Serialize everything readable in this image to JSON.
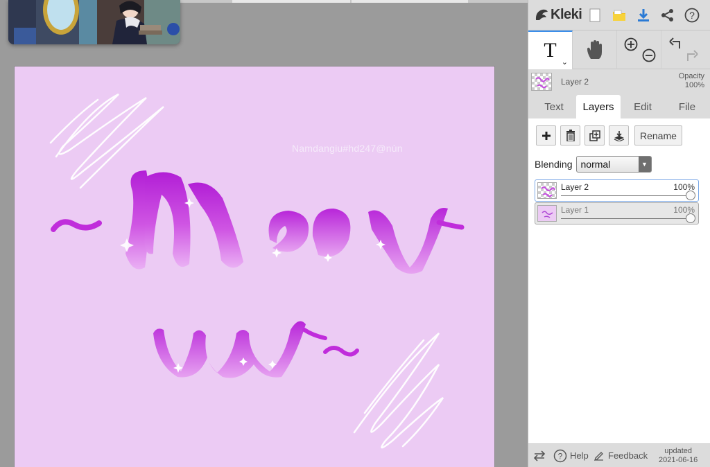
{
  "app": {
    "name": "Kleki"
  },
  "canvas": {
    "watermark": "Namdangiu#hd247@nùn",
    "background_color": "#eccbf4",
    "artwork": [
      {
        "id": "lettering-line-1",
        "kind": "lettering",
        "style": "pink/purple 3D brush script"
      },
      {
        "id": "lettering-line-2",
        "kind": "lettering",
        "style": "pink/purple 3D brush script"
      },
      {
        "id": "scribble-top-left",
        "kind": "scribble",
        "color": "#ffffff"
      },
      {
        "id": "scribble-bottom-right",
        "kind": "scribble",
        "color": "#ffffff"
      }
    ]
  },
  "toolbar": {
    "icons": [
      "new-file-icon",
      "open-folder-icon",
      "download-icon",
      "share-icon",
      "help-icon"
    ]
  },
  "tools": {
    "text_tool_glyph": "T",
    "active_tool": "text",
    "others": [
      "hand-icon",
      "zoom-in-icon",
      "zoom-out-icon",
      "undo-icon",
      "redo-icon"
    ]
  },
  "current_layer": {
    "name": "Layer 2",
    "opacity_label": "Opacity",
    "opacity_value": "100%"
  },
  "tabs": [
    {
      "label": "Text",
      "active": false
    },
    {
      "label": "Layers",
      "active": true
    },
    {
      "label": "Edit",
      "active": false
    },
    {
      "label": "File",
      "active": false
    }
  ],
  "layers_panel": {
    "rename_label": "Rename",
    "blending_label": "Blending",
    "blending_value": "normal",
    "layers": [
      {
        "name": "Layer 2",
        "opacity": "100%",
        "selected": true,
        "opacity_fraction": 1.0
      },
      {
        "name": "Layer 1",
        "opacity": "100%",
        "selected": false,
        "opacity_fraction": 1.0
      }
    ]
  },
  "bottom_bar": {
    "help_label": "Help",
    "feedback_label": "Feedback",
    "updated_label": "updated",
    "updated_date": "2021-06-16"
  },
  "colors": {
    "accent": "#3b8eea",
    "download_icon": "#2a7ad5",
    "folder_icon": "#f3c31c",
    "lettering_dark": "#b21fd6",
    "lettering_light": "#e9a6f2"
  }
}
